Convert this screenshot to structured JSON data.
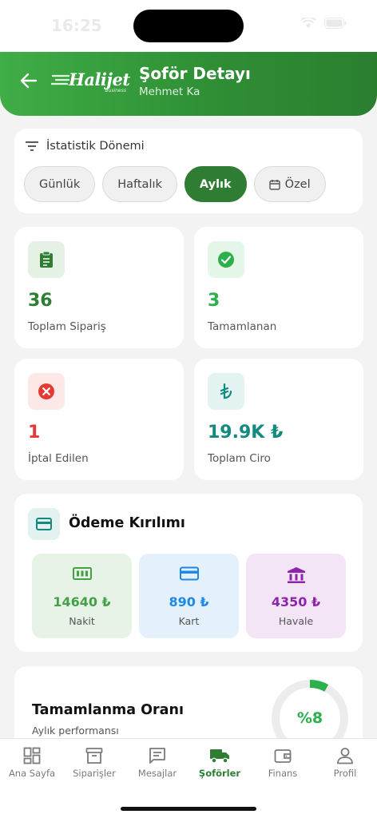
{
  "status_bar": {
    "time": "16:25"
  },
  "header": {
    "logo_text": "Halijet",
    "logo_sub": "Business",
    "title": "Şoför Detayı",
    "subtitle": "Mehmet Ka"
  },
  "period": {
    "heading": "İstatistik Dönemi",
    "options": [
      "Günlük",
      "Haftalık",
      "Aylık",
      "Özel"
    ],
    "selected": "Aylık"
  },
  "stats": [
    {
      "value": "36",
      "label": "Toplam Sipariş",
      "icon": "clipboard-icon",
      "color": "#2e7d32",
      "bg": "#e6f1e6"
    },
    {
      "value": "3",
      "label": "Tamamlanan",
      "icon": "check-circle-icon",
      "color": "#2bb04a",
      "bg": "#e4f6e8"
    },
    {
      "value": "1",
      "label": "İptal Edilen",
      "icon": "cancel-circle-icon",
      "color": "#e53935",
      "bg": "#fde8e8"
    },
    {
      "value": "19.9K ₺",
      "label": "Toplam Ciro",
      "icon": "lira-icon",
      "color": "#138a7e",
      "bg": "#e2f3f1"
    }
  ],
  "payment": {
    "title": "Ödeme Kırılımı",
    "items": [
      {
        "value": "14640 ₺",
        "label": "Nakit",
        "icon": "cash-icon",
        "color": "#43a047",
        "bg": "#e8f3e8"
      },
      {
        "value": "890 ₺",
        "label": "Kart",
        "icon": "credit-card-icon",
        "color": "#1e88e5",
        "bg": "#e4f0fb"
      },
      {
        "value": "4350 ₺",
        "label": "Havale",
        "icon": "bank-icon",
        "color": "#8e24aa",
        "bg": "#f3e5f6"
      }
    ]
  },
  "completion": {
    "title": "Tamamlanma Oranı",
    "subtitle": "Aylık performansı",
    "percent_label": "%8",
    "percent": 8
  },
  "tabbar": {
    "items": [
      {
        "label": "Ana Sayfa",
        "icon": "dashboard-icon"
      },
      {
        "label": "Siparişler",
        "icon": "archive-icon"
      },
      {
        "label": "Mesajlar",
        "icon": "message-icon"
      },
      {
        "label": "Şoförler",
        "icon": "truck-icon"
      },
      {
        "label": "Finans",
        "icon": "wallet-icon"
      },
      {
        "label": "Profil",
        "icon": "person-icon"
      }
    ],
    "active": "Şoförler"
  },
  "colors": {
    "brand": "#2e7d32",
    "accent": "#2bb04a"
  }
}
